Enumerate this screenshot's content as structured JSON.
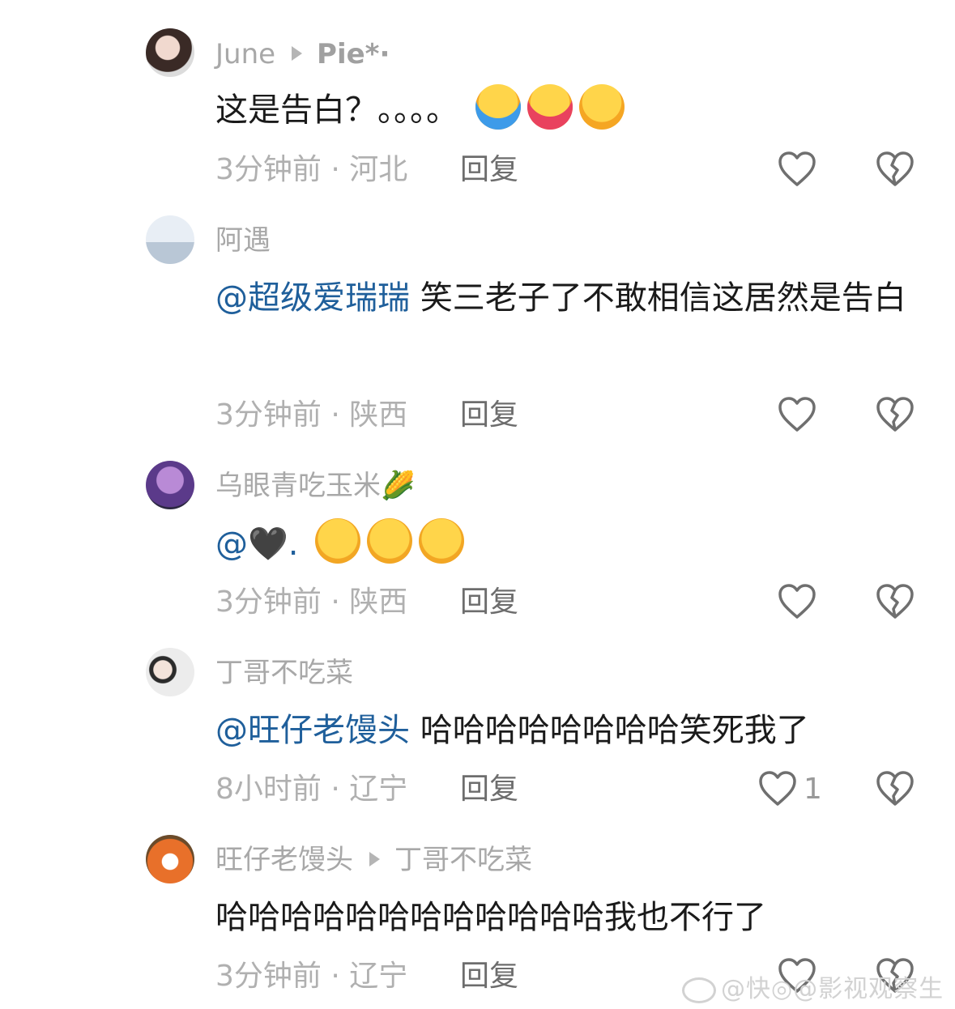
{
  "comments": [
    {
      "user": "June",
      "reply_to": "Pie*·",
      "text": "这是告白？。。。。",
      "mention": "",
      "emojis": [
        "loudly-crying",
        "hugging",
        "holding-back-tears"
      ],
      "time": "3分钟前",
      "location": "河北",
      "reply_label": "回复",
      "likes": ""
    },
    {
      "user": "阿遇",
      "reply_to": "",
      "mention": "@超级爱瑞瑞",
      "text": " 笑三老子了不敢相信这居然是告白",
      "emojis": [],
      "time": "3分钟前",
      "location": "陕西",
      "reply_label": "回复",
      "likes": ""
    },
    {
      "user": "乌眼青吃玉米🌽",
      "reply_to": "",
      "mention": "@🖤.",
      "text": "",
      "emojis": [
        "flushed",
        "flushed",
        "flushed"
      ],
      "time": "3分钟前",
      "location": "陕西",
      "reply_label": "回复",
      "likes": ""
    },
    {
      "user": "丁哥不吃菜",
      "reply_to": "",
      "mention": "@旺仔老馒头",
      "text": " 哈哈哈哈哈哈哈哈笑死我了",
      "emojis": [],
      "time": "8小时前",
      "location": "辽宁",
      "reply_label": "回复",
      "likes": "1"
    },
    {
      "user": "旺仔老馒头",
      "reply_to": "丁哥不吃菜",
      "mention": "",
      "text": "哈哈哈哈哈哈哈哈哈哈哈哈我也不行了",
      "emojis": [],
      "time": "3分钟前",
      "location": "辽宁",
      "reply_label": "回复",
      "likes": ""
    }
  ],
  "sep": " · ",
  "watermark": "@快◎@影视观察生",
  "colors": {
    "mention": "#1f5f9b",
    "meta": "#b0b0b0",
    "text": "#1a1a1a"
  }
}
